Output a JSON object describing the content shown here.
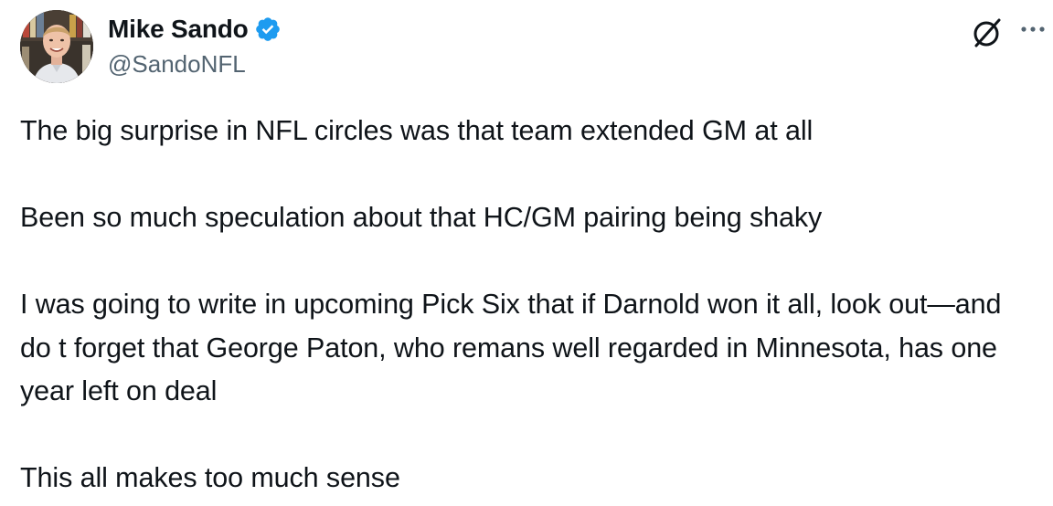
{
  "author": {
    "display_name": "Mike Sando",
    "handle": "@SandoNFL",
    "verified": true,
    "verified_color": "#1d9bf0"
  },
  "icons": {
    "avatar": "avatar-photo",
    "verified": "verified-badge-icon",
    "grok": "grok-icon",
    "more": "more-options-icon"
  },
  "tweet": {
    "paragraphs": [
      "The big surprise in NFL circles was that team extended GM at all",
      "Been so much speculation about that HC/GM pairing being shaky",
      "I was going to write in upcoming Pick Six that if Darnold won it all, look out—and do t forget that George Paton, who remans well regarded in Minnesota, has one year left on deal",
      "This all makes too much sense"
    ]
  },
  "colors": {
    "text": "#0f1419",
    "secondary_text": "#536471",
    "accent": "#1d9bf0"
  }
}
